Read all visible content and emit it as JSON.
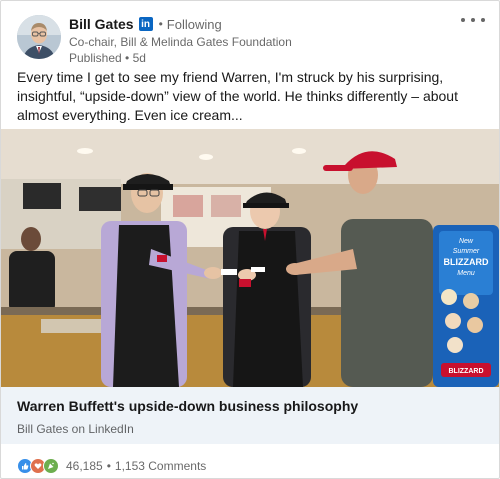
{
  "author": {
    "name": "Bill Gates",
    "linkedin_badge": "in",
    "separator": "•",
    "follow_status": "Following",
    "headline": "Co-chair, Bill & Melinda Gates Foundation",
    "published": "Published • 5d"
  },
  "post": {
    "text": "Every time I get to see my friend Warren, I'm struck by his surprising, insightful, “upside-down” view of the world. He thinks differently – about almost everything. Even ice cream..."
  },
  "media": {
    "sign_lines": [
      "New",
      "Summer",
      "BLIZZARD",
      "Menu",
      "BLIZZARD"
    ]
  },
  "link": {
    "title": "Warren Buffett's upside-down business philosophy",
    "source": "Bill Gates on LinkedIn"
  },
  "social": {
    "reaction_icons": [
      "like-icon",
      "love-icon",
      "celebrate-icon"
    ],
    "reactions_count": "46,185",
    "separator": "•",
    "comments": "1,153 Comments"
  },
  "colors": {
    "linkedin_blue": "#0a66c2",
    "link_bg": "#eef3f8",
    "like": "#378fe9",
    "love": "#df704d",
    "celebrate": "#6dae4f",
    "cap_red": "#c8102e"
  }
}
